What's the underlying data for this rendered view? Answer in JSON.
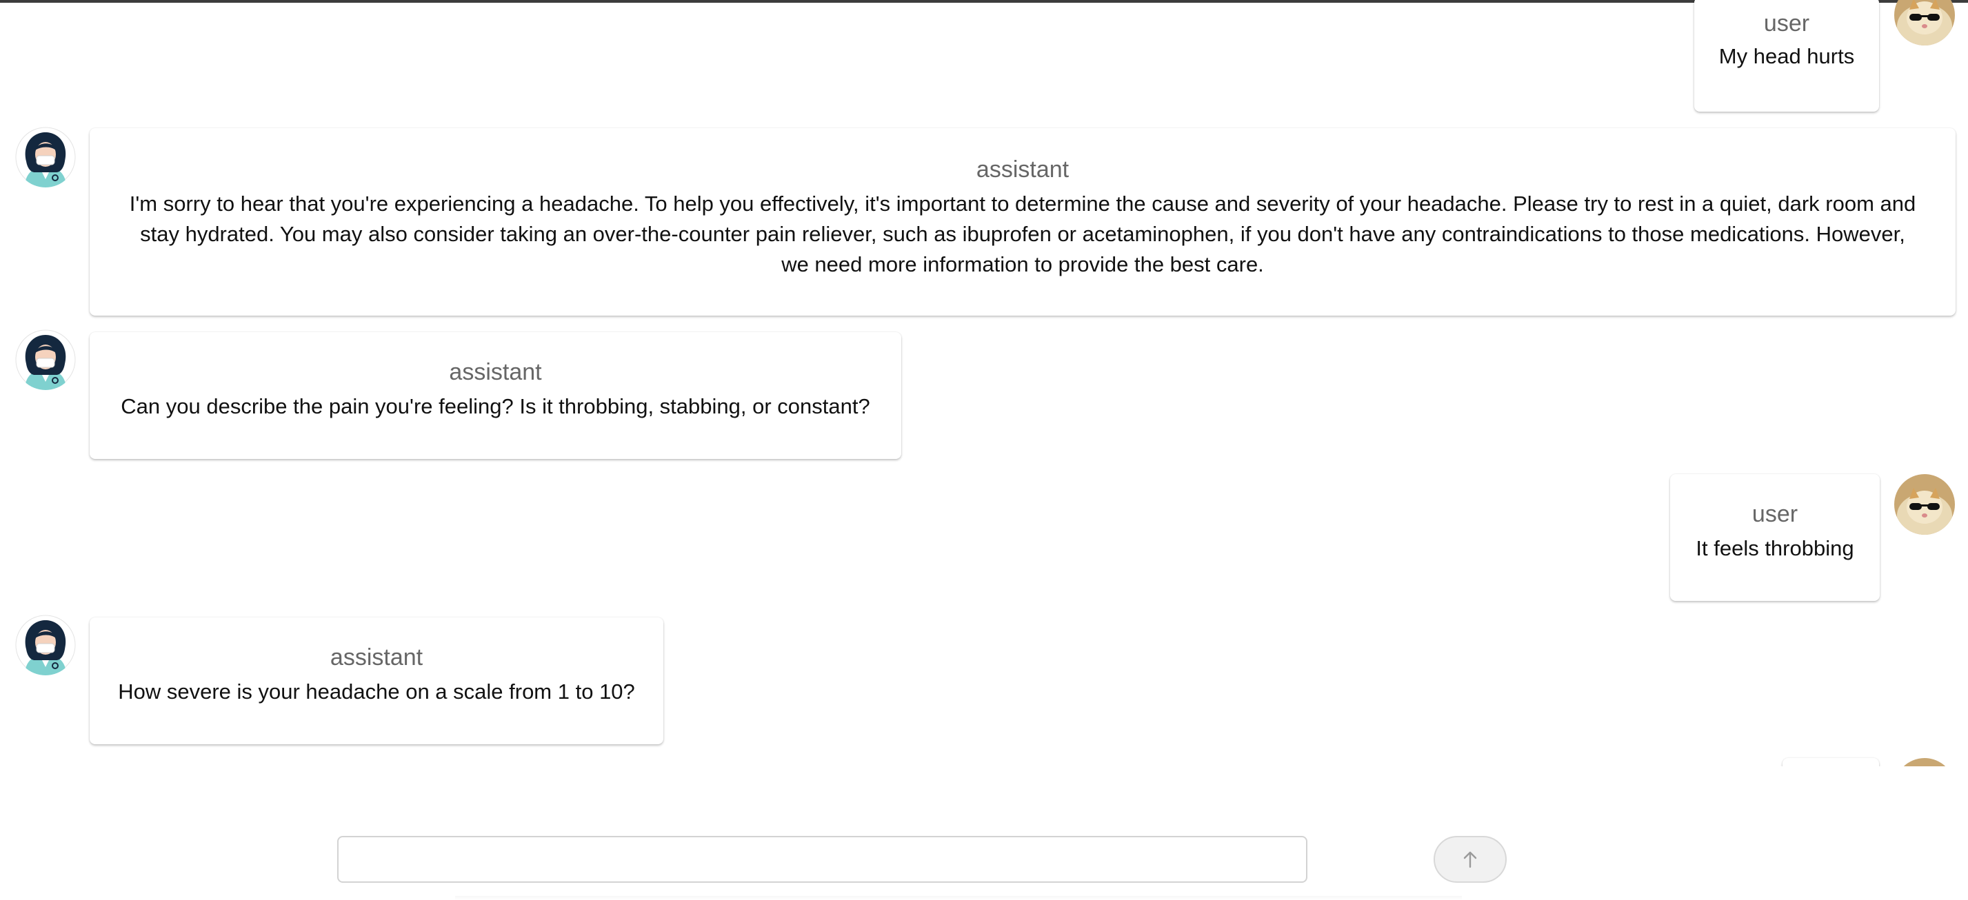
{
  "messages": [
    {
      "role": "user",
      "text": "My head hurts"
    },
    {
      "role": "assistant",
      "text": "I'm sorry to hear that you're experiencing a headache. To help you effectively, it's important to determine the cause and severity of your headache. Please try to rest in a quiet, dark room and stay hydrated. You may also consider taking an over-the-counter pain reliever, such as ibuprofen or acetaminophen, if you don't have any contraindications to those medications. However, we need more information to provide the best care."
    },
    {
      "role": "assistant",
      "text": "Can you describe the pain you're feeling? Is it throbbing, stabbing, or constant?"
    },
    {
      "role": "user",
      "text": "It feels throbbing"
    },
    {
      "role": "assistant",
      "text": "How severe is your headache on a scale from 1 to 10?"
    }
  ],
  "composer": {
    "placeholder": "",
    "value": ""
  },
  "icons": {
    "user_avatar": "cat-with-sunglasses-avatar",
    "assistant_avatar": "doctor-avatar",
    "send": "arrow-up-icon"
  },
  "colors": {
    "role_label": "#666666",
    "message_text": "#111111",
    "send_button_bg": "#f1f1f1",
    "avatar_user_bg": "#c9a772",
    "avatar_assistant_hair": "#14283f",
    "avatar_assistant_coat": "#7fd1cf"
  }
}
